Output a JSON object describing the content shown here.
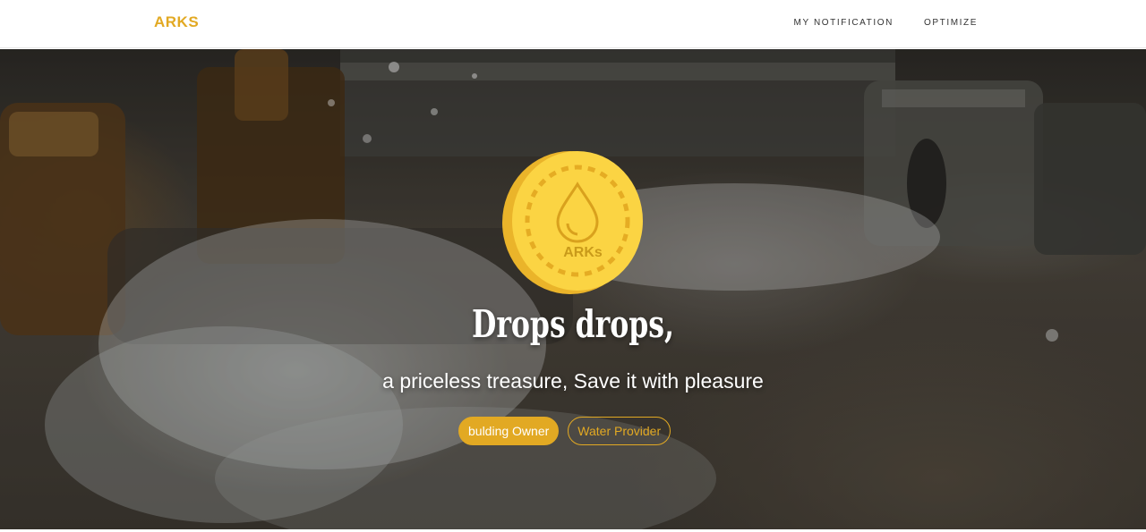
{
  "navbar": {
    "brand": "ARKS",
    "links": [
      {
        "label": "MY NOTIFICATION"
      },
      {
        "label": "OPTIMIZE"
      }
    ]
  },
  "hero": {
    "background_image": "water-gushing-pipe-photo",
    "logo": {
      "icon": "water-drop-icon",
      "text": "ARKs"
    },
    "headline": "Drops drops,",
    "subheadline": "a priceless treasure, Save it with pleasure",
    "buttons": {
      "primary_label": "bulding Owner",
      "secondary_label": "Water Provider"
    }
  },
  "colors": {
    "accent": "#e2a923",
    "coin_light": "#fbd443",
    "coin_dark": "#eab42a",
    "white": "#ffffff"
  }
}
